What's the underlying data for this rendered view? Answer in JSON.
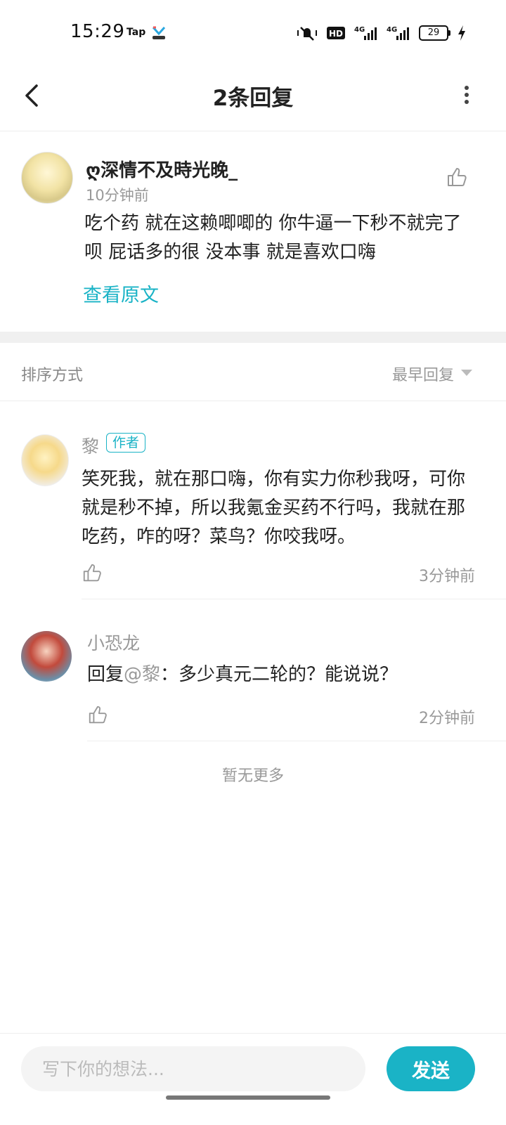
{
  "status_bar": {
    "time": "15:29",
    "carrier_tag": "Tap",
    "network_1": "4G",
    "network_2": "4G",
    "hd_label": "HD",
    "battery": "29"
  },
  "header": {
    "title": "2条回复"
  },
  "main_comment": {
    "username": "ღ深情不及時光晚_",
    "time": "10分钟前",
    "text": "吃个药 就在这赖唧唧的 你牛逼一下秒不就完了呗 屁话多的很 没本事 就是喜欢口嗨",
    "view_original": "查看原文"
  },
  "sort": {
    "label": "排序方式",
    "value": "最早回复"
  },
  "replies": [
    {
      "username": "黎",
      "badge": "作者",
      "text": "笑死我，就在那口嗨，你有实力你秒我呀，可你就是秒不掉，所以我氪金买药不行吗，我就在那吃药，咋的呀？菜鸟？你咬我呀。",
      "time": "3分钟前"
    },
    {
      "username": "小恐龙",
      "reply_prefix": "回复",
      "mention": "@黎",
      "text": "：多少真元二轮的？能说说？",
      "time": "2分钟前"
    }
  ],
  "no_more": "暂无更多",
  "composer": {
    "placeholder": "写下你的想法...",
    "send_label": "发送"
  },
  "colors": {
    "accent": "#1ab3c6",
    "muted_text": "#999999"
  }
}
